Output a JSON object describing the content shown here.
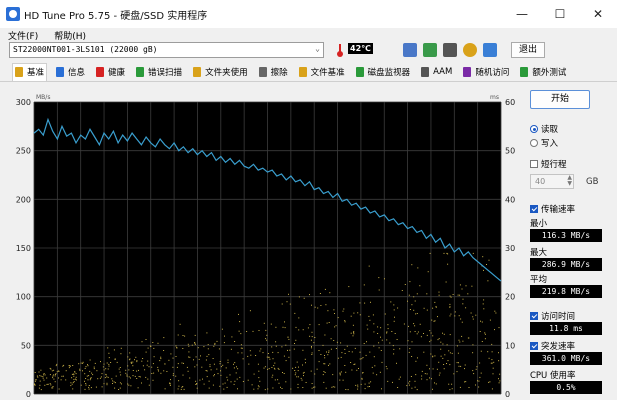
{
  "window": {
    "title": "HD Tune Pro 5.75 - 硬盘/SSD 实用程序",
    "minimize": "—",
    "maximize": "☐",
    "close": "✕"
  },
  "menu": {
    "file": "文件(F)",
    "help": "帮助(H)"
  },
  "toolbar": {
    "drive": "ST22000NT001-3LS101 (22000 gB)",
    "temperature": "42℃",
    "exit_label": "退出"
  },
  "tabs": [
    {
      "label": "基准",
      "icon": "benchmark-icon",
      "color": "#d9a21a"
    },
    {
      "label": "信息",
      "icon": "info-icon",
      "color": "#2a6fd6"
    },
    {
      "label": "健康",
      "icon": "health-icon",
      "color": "#d62222"
    },
    {
      "label": "错误扫描",
      "icon": "scan-icon",
      "color": "#2a9a3a"
    },
    {
      "label": "文件夹使用",
      "icon": "folder-icon",
      "color": "#d9a21a"
    },
    {
      "label": "擦除",
      "icon": "erase-icon",
      "color": "#666666"
    },
    {
      "label": "文件基准",
      "icon": "file-benchmark-icon",
      "color": "#d9a21a"
    },
    {
      "label": "磁盘监视器",
      "icon": "monitor-icon",
      "color": "#2a9a3a"
    },
    {
      "label": "AAM",
      "icon": "aam-icon",
      "color": "#555555"
    },
    {
      "label": "随机访问",
      "icon": "random-access-icon",
      "color": "#7a2aa6"
    },
    {
      "label": "额外测试",
      "icon": "extra-tests-icon",
      "color": "#2a9a3a"
    }
  ],
  "panel": {
    "start_label": "开始",
    "read_label": "读取",
    "write_label": "写入",
    "short_stroke_label": "短行程",
    "short_stroke_value": "40",
    "gb_label": "GB",
    "transfer_label": "传输速率",
    "min_label": "最小",
    "min_value": "116.3 MB/s",
    "max_label": "最大",
    "max_value": "286.9 MB/s",
    "avg_label": "平均",
    "avg_value": "219.8 MB/s",
    "access_label": "访问时间",
    "access_value": "11.8 ms",
    "burst_label": "突发速率",
    "burst_value": "361.0 MB/s",
    "cpu_label": "CPU 使用率",
    "cpu_value": "0.5%"
  },
  "chart_data": {
    "type": "line",
    "y_left_unit": "MB/s",
    "y_right_unit": "ms",
    "y_left_ticks": [
      0,
      50,
      100,
      150,
      200,
      250,
      300
    ],
    "y_right_ticks": [
      0,
      10,
      20,
      30,
      40,
      50,
      60
    ],
    "y_left_range": [
      0,
      300
    ],
    "y_right_range": [
      0,
      60
    ],
    "x_range": [
      0,
      100
    ],
    "grid": true,
    "colors": {
      "background": "#000000",
      "grid": "#3c3c3c",
      "line": "#3a9fcf",
      "points": "#c8b048"
    },
    "series": [
      {
        "values": [
          268,
          272,
          266,
          282,
          270,
          262,
          275,
          265,
          268,
          258,
          266,
          262,
          272,
          264,
          256,
          268,
          262,
          270,
          258,
          266,
          260,
          268,
          262,
          256,
          264,
          258,
          254,
          262,
          256,
          252,
          258,
          250,
          254,
          248,
          252,
          246,
          250,
          244,
          248,
          240,
          244,
          238,
          242,
          236,
          240,
          234,
          232,
          236,
          230,
          232,
          228,
          230,
          224,
          226,
          220,
          224,
          218,
          220,
          214,
          218,
          210,
          212,
          206,
          208,
          202,
          206,
          198,
          200,
          194,
          196,
          190,
          192,
          186,
          188,
          182,
          184,
          178,
          180,
          174,
          176,
          170,
          172,
          166,
          168,
          160,
          164,
          156,
          160,
          150,
          154,
          146,
          150,
          142,
          146,
          140,
          136,
          132,
          128,
          124,
          120,
          116
        ]
      },
      {
        "type": "scatter",
        "y_axis": "right",
        "points_note": "access time samples",
        "y_min": 1,
        "y_max": 29
      }
    ]
  }
}
